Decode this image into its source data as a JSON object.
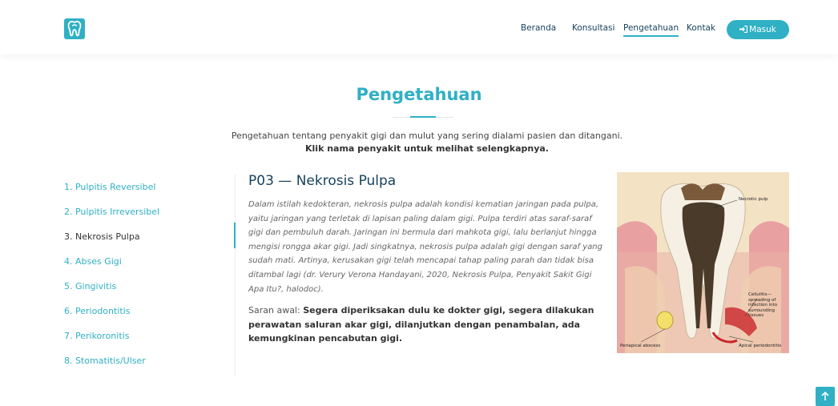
{
  "header": {
    "logo_icon": "tooth-icon",
    "nav": [
      "Beranda",
      "Konsultasi",
      "Pengetahuan",
      "Kontak"
    ],
    "active_nav": "Pengetahuan",
    "login_label": "Masuk",
    "login_icon": "sign-in-icon"
  },
  "page": {
    "title": "Pengetahuan",
    "intro": "Pengetahuan tentang penyakit gigi dan mulut yang sering dialami pasien dan ditangani.",
    "intro_bold": "Klik nama penyakit untuk melihat selengkapnya."
  },
  "sidebar": {
    "items": [
      "1. Pulpitis Reversibel",
      "2. Pulpitis Irreversibel",
      "3. Nekrosis Pulpa",
      "4. Abses Gigi",
      "5. Gingivitis",
      "6. Periodontitis",
      "7. Perikoronitis",
      "8. Stomatitis/Ulser"
    ],
    "active_index": 2
  },
  "content": {
    "title": "P03 — Nekrosis Pulpa",
    "description": "Dalam istilah kedokteran, nekrosis pulpa adalah kondisi kematian jaringan pada pulpa, yaitu jaringan yang terletak di lapisan paling dalam gigi. Pulpa terdiri atas saraf-saraf gigi dan pembuluh darah. Jaringan ini bermula dari mahkota gigi, lalu berlanjut hingga mengisi rongga akar gigi. Jadi singkatnya, nekrosis pulpa adalah gigi dengan saraf yang sudah mati. Artinya, kerusakan gigi telah mencapai tahap paling parah dan tidak bisa ditambal lagi (dr. Verury Verona Handayani, 2020, Nekrosis Pulpa, Penyakit Sakit Gigi Apa Itu?, halodoc).",
    "advice_label": "Saran awal: ",
    "advice": "Segera diperiksakan dulu ke dokter gigi, segera dilakukan perawatan saluran akar gigi, dilanjutkan dengan penambalan, ada kemungkinan pencabutan gigi."
  },
  "illustration": {
    "labels": {
      "necrotic": "Necrotic pulp",
      "cellulitis": "Cellulitis—\nspreading of\ninfection into\nsurrounding\ntissues",
      "abscess": "Periapical abscess",
      "periodontitis": "Apical periodontitis"
    }
  },
  "colors": {
    "accent": "#2fb0c4",
    "navy": "#153f5c"
  },
  "back_to_top_icon": "arrow-up-icon"
}
